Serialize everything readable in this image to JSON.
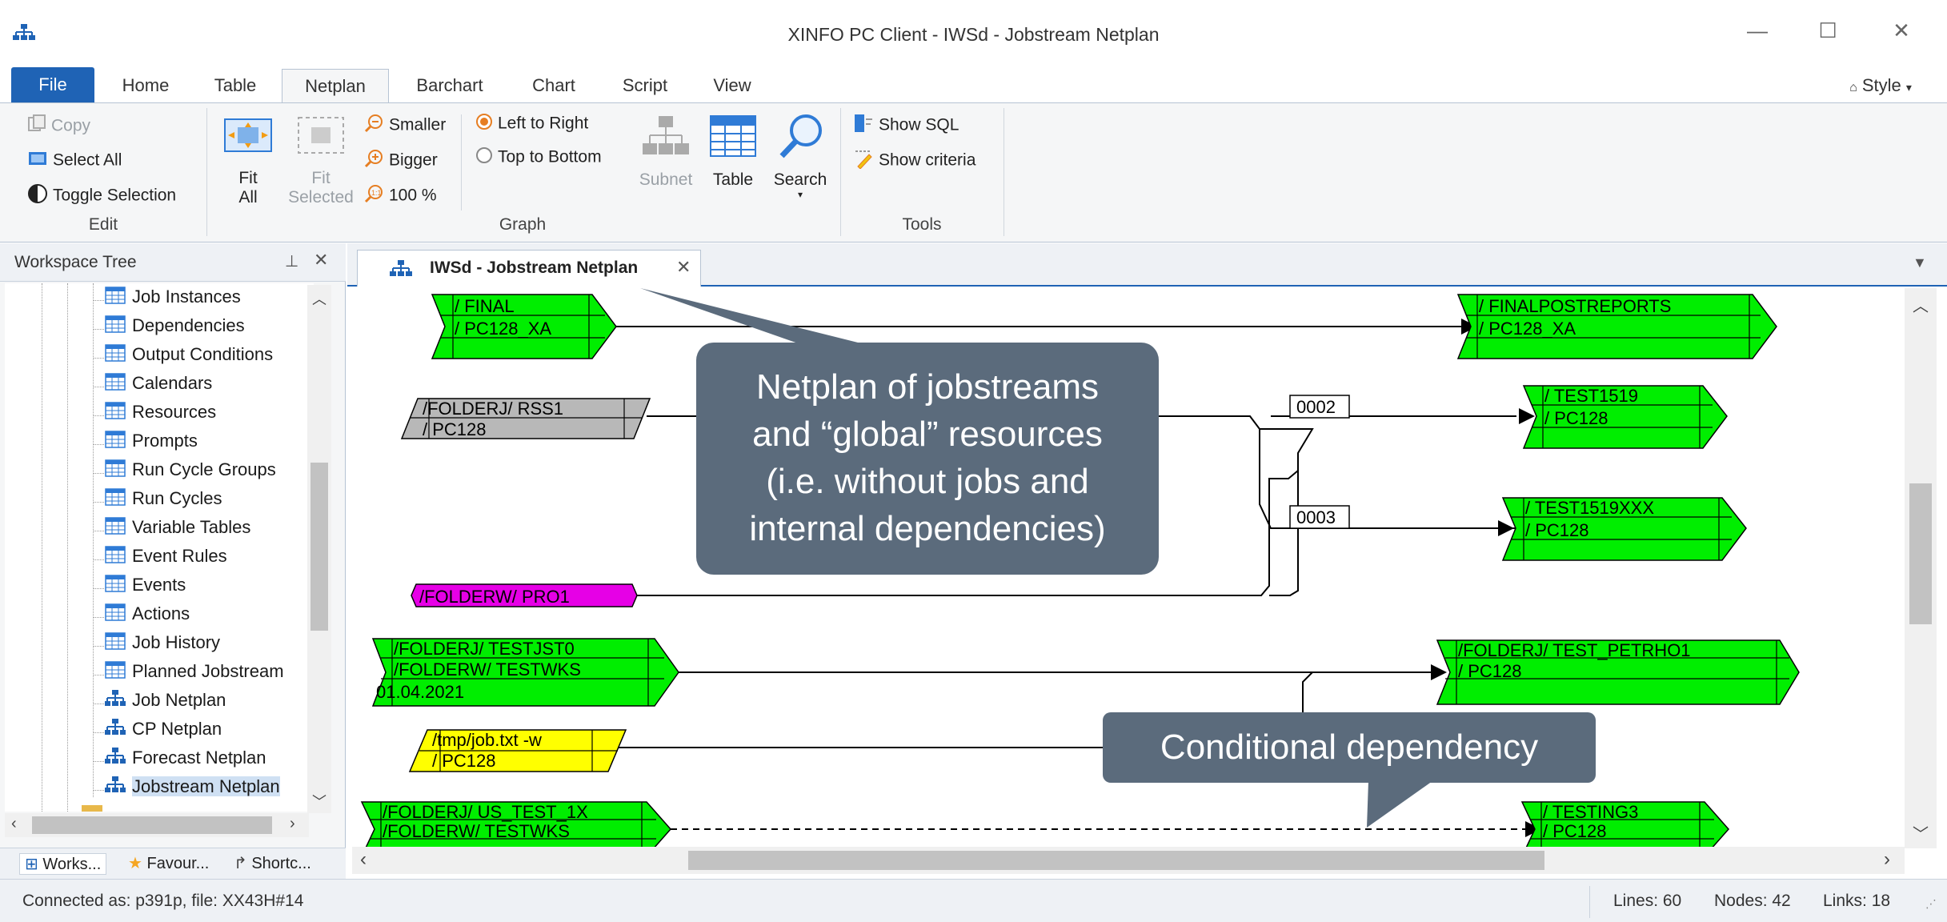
{
  "window": {
    "title": "XINFO PC Client - IWSd - Jobstream Netplan",
    "minimize": "—",
    "maximize": "☐",
    "close": "✕"
  },
  "ribbon_tabs": [
    "File",
    "Home",
    "Table",
    "Netplan",
    "Barchart",
    "Chart",
    "Script",
    "View"
  ],
  "style_menu": "Style",
  "ribbon": {
    "edit": {
      "label": "Edit",
      "copy": "Copy",
      "select_all": "Select All",
      "toggle_selection": "Toggle Selection"
    },
    "graph": {
      "label": "Graph",
      "fit_all": "Fit\nAll",
      "fit_all_1": "Fit",
      "fit_all_2": "All",
      "fit_selected_1": "Fit",
      "fit_selected_2": "Selected",
      "smaller": "Smaller",
      "bigger": "Bigger",
      "zoom": "100 %",
      "left_to_right": "Left to Right",
      "top_to_bottom": "Top to Bottom",
      "subnet": "Subnet",
      "table": "Table",
      "search": "Search"
    },
    "tools": {
      "label": "Tools",
      "show_sql": "Show SQL",
      "show_criteria": "Show criteria"
    }
  },
  "workspace": {
    "title": "Workspace Tree",
    "items": [
      {
        "label": "Job Instances",
        "icon": "table-icon"
      },
      {
        "label": "Dependencies",
        "icon": "table-icon"
      },
      {
        "label": "Output Conditions",
        "icon": "table-icon"
      },
      {
        "label": "Calendars",
        "icon": "table-icon"
      },
      {
        "label": "Resources",
        "icon": "table-icon"
      },
      {
        "label": "Prompts",
        "icon": "table-icon"
      },
      {
        "label": "Run Cycle Groups",
        "icon": "table-icon"
      },
      {
        "label": "Run Cycles",
        "icon": "table-icon"
      },
      {
        "label": "Variable Tables",
        "icon": "table-icon"
      },
      {
        "label": "Event Rules",
        "icon": "table-icon"
      },
      {
        "label": "Events",
        "icon": "table-icon"
      },
      {
        "label": "Actions",
        "icon": "table-icon"
      },
      {
        "label": "Job History",
        "icon": "table-icon"
      },
      {
        "label": "Planned Jobstream",
        "icon": "table-icon"
      },
      {
        "label": "Job Netplan",
        "icon": "netplan-icon"
      },
      {
        "label": "CP Netplan",
        "icon": "netplan-icon"
      },
      {
        "label": "Forecast Netplan",
        "icon": "netplan-icon"
      },
      {
        "label": "Jobstream Netplan",
        "icon": "netplan-icon",
        "selected": true
      }
    ],
    "bottom_tabs": [
      "Works...",
      "Favour...",
      "Shortc..."
    ]
  },
  "document": {
    "tab_title": "IWSd - Jobstream Netplan"
  },
  "netplan": {
    "nodes": [
      {
        "id": "final",
        "row1": "/ FINAL",
        "row2": "/ PC128_XA",
        "color": "#00ee00"
      },
      {
        "id": "finalpost",
        "row1": "/ FINALPOSTREPORTS",
        "row2": "/ PC128_XA",
        "color": "#00ee00"
      },
      {
        "id": "rss1",
        "row1": "/FOLDERJ/ RSS1",
        "row2": "/ PC128",
        "color": "#b8b8b8"
      },
      {
        "id": "test1519",
        "row1": "/ TEST1519",
        "row2": "/ PC128",
        "color": "#00ee00"
      },
      {
        "id": "test1519xxx",
        "row1": "/ TEST1519XXX",
        "row2": "/ PC128",
        "color": "#00ee00"
      },
      {
        "id": "pro1",
        "row1": "/FOLDERW/ PRO1",
        "color": "#e600e6"
      },
      {
        "id": "testjst0",
        "row1": "/FOLDERJ/ TESTJST0",
        "row2": "/FOLDERW/ TESTWKS",
        "row3": "01.04.2021",
        "color": "#00ee00"
      },
      {
        "id": "petrho1",
        "row1": "/FOLDERJ/ TEST_PETRHO1",
        "row2": "/ PC128",
        "color": "#00ee00"
      },
      {
        "id": "jobtxt",
        "row1": "/tmp/job.txt -w",
        "row2": "/ PC128",
        "color": "#ffff00"
      },
      {
        "id": "ustest",
        "row1": "/FOLDERJ/ US_TEST_1X",
        "row2": "/FOLDERW/ TESTWKS",
        "color": "#00ee00"
      },
      {
        "id": "testing3",
        "row1": "/ TESTING3",
        "row2": "/ PC128",
        "color": "#00ee00"
      }
    ],
    "labels": [
      "0002",
      "0003"
    ]
  },
  "callouts": {
    "netplan_line1": "Netplan of jobstreams",
    "netplan_line2": "and “global” resources",
    "netplan_line3": "(i.e. without jobs and",
    "netplan_line4": "internal dependencies)",
    "conditional": "Conditional dependency"
  },
  "status": {
    "connection": "Connected as: p391p, file: XX43H#14",
    "lines": "Lines: 60",
    "nodes": "Nodes: 42",
    "links": "Links: 18"
  },
  "colors": {
    "accent": "#1f63b5",
    "callout": "#5b6b7c",
    "node_green": "#00ee00",
    "node_gray": "#b8b8b8",
    "node_magenta": "#e600e6",
    "node_yellow": "#ffff00"
  }
}
